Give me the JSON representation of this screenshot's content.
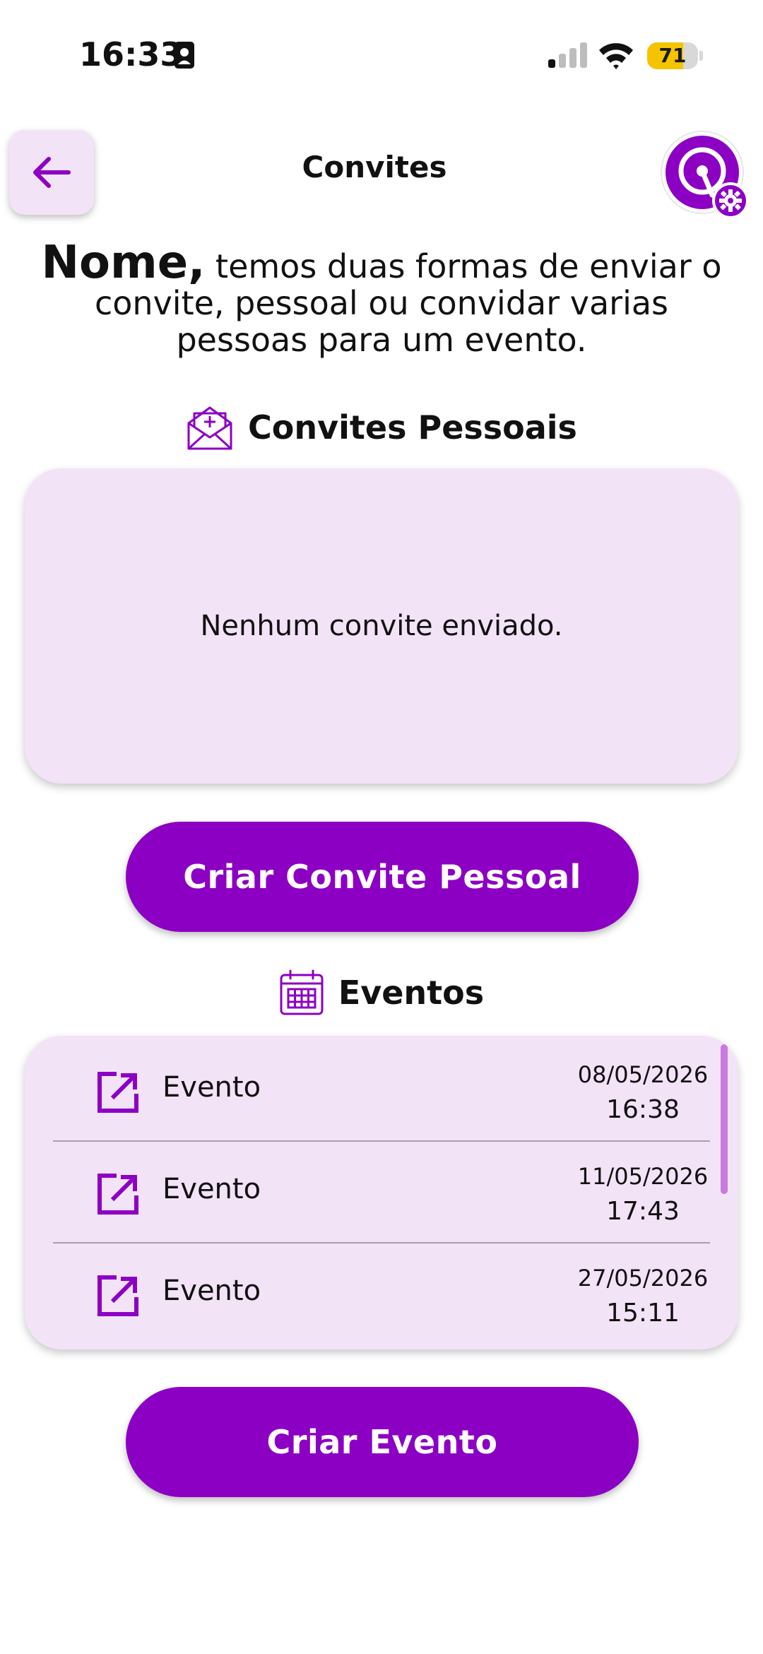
{
  "status_bar": {
    "time": "16:33",
    "battery_percent": "71",
    "battery_level": 0.71,
    "icons": [
      "contact-card-icon",
      "signal-icon",
      "wifi-icon",
      "battery-icon"
    ]
  },
  "header": {
    "title": "Convites",
    "back_icon": "arrow-left-icon",
    "profile_icon": "app-logo-settings-icon"
  },
  "intro": {
    "name": "Nome,",
    "text": " temos duas formas de enviar o convite, pessoal ou convidar varias pessoas para um evento."
  },
  "personal_section": {
    "heading": "Convites Pessoais",
    "icon": "envelope-plus-icon",
    "empty_text": "Nenhum convite enviado.",
    "button_label": "Criar Convite Pessoal"
  },
  "events_section": {
    "heading": "Eventos",
    "icon": "calendar-icon",
    "items": [
      {
        "name": "Evento",
        "date": "08/05/2026",
        "time": "16:38"
      },
      {
        "name": "Evento",
        "date": "11/05/2026",
        "time": "17:43"
      },
      {
        "name": "Evento",
        "date": "27/05/2026",
        "time": "15:11"
      }
    ],
    "button_label": "Criar Evento"
  },
  "colors": {
    "primary": "#8c00c4",
    "card_bg": "#f3e3f7",
    "battery": "#f5c400"
  }
}
